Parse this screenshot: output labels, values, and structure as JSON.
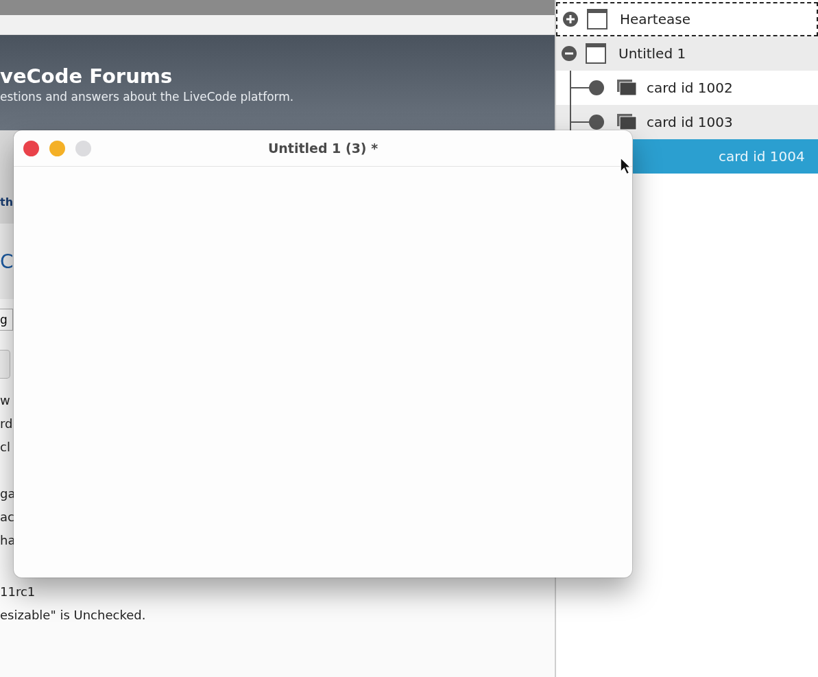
{
  "forum": {
    "title": "veCode Forums",
    "subtitle": "estions and answers about the LiveCode platform.",
    "fragments": [
      {
        "kind": "link",
        "text": "th"
      },
      {
        "kind": "heading",
        "text": "C"
      },
      {
        "kind": "field",
        "text": "g"
      },
      {
        "kind": "button"
      },
      {
        "kind": "line",
        "text": "w"
      },
      {
        "kind": "line",
        "text": "rd"
      },
      {
        "kind": "line",
        "text": "cl"
      },
      {
        "kind": "gap"
      },
      {
        "kind": "line",
        "text": "ga"
      },
      {
        "kind": "line",
        "text": "ac"
      },
      {
        "kind": "line",
        "text": "ha"
      }
    ],
    "footer_lines": [
      "11rc1",
      "esizable\" is Unchecked."
    ]
  },
  "tree": [
    {
      "kind": "stack",
      "label": "Heartease",
      "expanded": false,
      "focused": true,
      "selected": false
    },
    {
      "kind": "stack",
      "label": "Untitled 1",
      "expanded": true,
      "focused": false,
      "selected": false,
      "children": [
        {
          "kind": "card",
          "label": "card id 1002",
          "selected": false
        },
        {
          "kind": "card",
          "label": "card id 1003",
          "selected": false
        },
        {
          "kind": "card",
          "label": "card id 1004",
          "selected": true
        }
      ]
    }
  ],
  "window": {
    "title": "Untitled 1 (3) *"
  }
}
